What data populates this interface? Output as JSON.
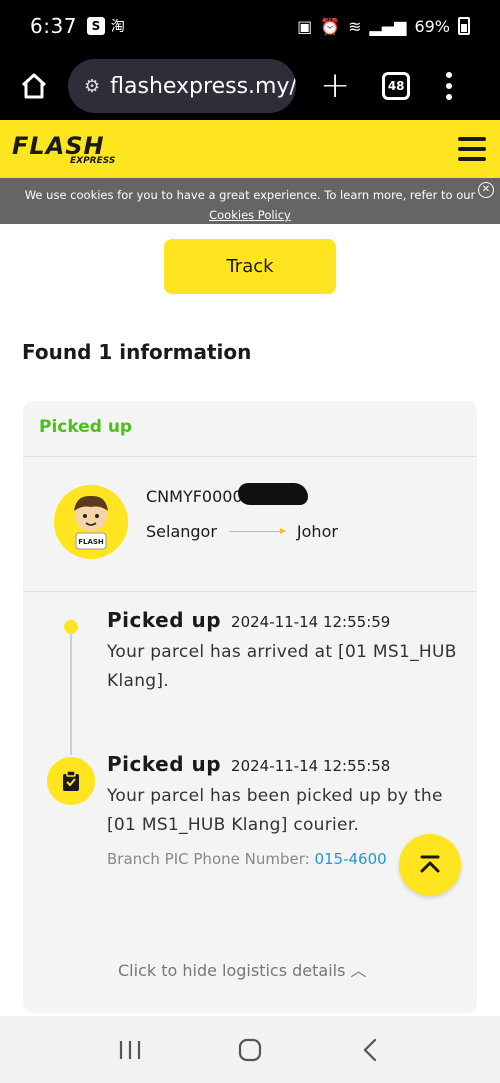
{
  "status_bar": {
    "time": "6:37",
    "left_icons": [
      "shopping-bag-icon",
      "taobao-icon"
    ],
    "right_icons": [
      "battery-saver-icon",
      "alarm-icon",
      "wifi-icon",
      "call-icon",
      "signal-icon"
    ],
    "battery": "69%"
  },
  "browser": {
    "url": "flashexpress.my/t",
    "tab_count": "48"
  },
  "site_header": {
    "logo_text": "FLASH",
    "logo_sub": "EXPRESS"
  },
  "cookie_banner": {
    "text": "We use cookies for you to have a great experience. To learn more, refer to our",
    "link": "Cookies Policy"
  },
  "search": {
    "track_label": "Track"
  },
  "results": {
    "heading": "Found 1 information",
    "card": {
      "status": "Picked up",
      "tracking_number": "CNMYF0000",
      "route_from": "Selangor",
      "route_to": "Johor",
      "events": [
        {
          "title": "Picked up",
          "time": "2024-11-14 12:55:59",
          "description": "Your parcel has arrived at [01 MS1_HUB Klang]."
        },
        {
          "title": "Picked up",
          "time": "2024-11-14 12:55:58",
          "description": "Your parcel has been picked up by the [01 MS1_HUB Klang] courier.",
          "phone_label": "Branch PIC Phone Number:",
          "phone_number": "015-4600"
        }
      ],
      "toggle_label": "Click to hide logistics details"
    }
  },
  "colors": {
    "brand_yellow": "#ffe51f",
    "status_green": "#4cc119",
    "link_blue": "#1b9ad6"
  }
}
